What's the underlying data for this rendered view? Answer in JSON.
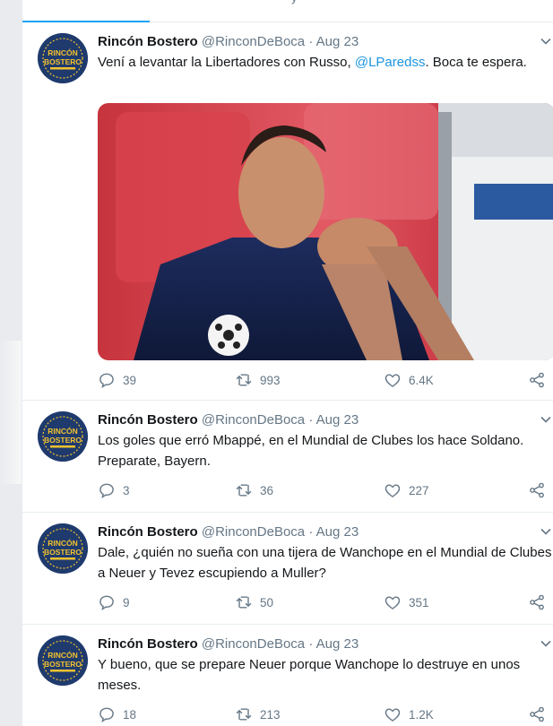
{
  "colors": {
    "accent": "#1da1f2",
    "mention": "#1b95e0",
    "muted": "#657786",
    "text": "#14171a"
  },
  "tab_fragment": "y",
  "tweets": [
    {
      "author_name": "Rincón Bostero",
      "author_handle": "@RinconDeBoca",
      "separator": "·",
      "date": "Aug 23",
      "text_before": "Vení a levantar la Libertadores con Russo, ",
      "mention": "@LParedss",
      "text_after": ". Boca te espera.",
      "has_media": true,
      "replies": "39",
      "retweets": "993",
      "likes": "6.4K"
    },
    {
      "author_name": "Rincón Bostero",
      "author_handle": "@RinconDeBoca",
      "separator": "·",
      "date": "Aug 23",
      "text": "Los goles que erró Mbappé, en el Mundial de Clubes los hace Soldano. Preparate, Bayern.",
      "replies": "3",
      "retweets": "36",
      "likes": "227"
    },
    {
      "author_name": "Rincón Bostero",
      "author_handle": "@RinconDeBoca",
      "separator": "·",
      "date": "Aug 23",
      "text": "Dale, ¿quién no sueña con una tijera de Wanchope en el Mundial de Clubes a Neuer y Tevez escupiendo a Muller?",
      "replies": "9",
      "retweets": "50",
      "likes": "351"
    },
    {
      "author_name": "Rincón Bostero",
      "author_handle": "@RinconDeBoca",
      "separator": "·",
      "date": "Aug 23",
      "text": "Y bueno, que se prepare Neuer porque Wanchope lo destruye en unos meses.",
      "replies": "18",
      "retweets": "213",
      "likes": "1.2K"
    }
  ],
  "avatar_lettering": "RINCÓN BOSTERO",
  "icons": [
    "reply-icon",
    "retweet-icon",
    "like-icon",
    "share-icon",
    "chevron-down-icon"
  ]
}
